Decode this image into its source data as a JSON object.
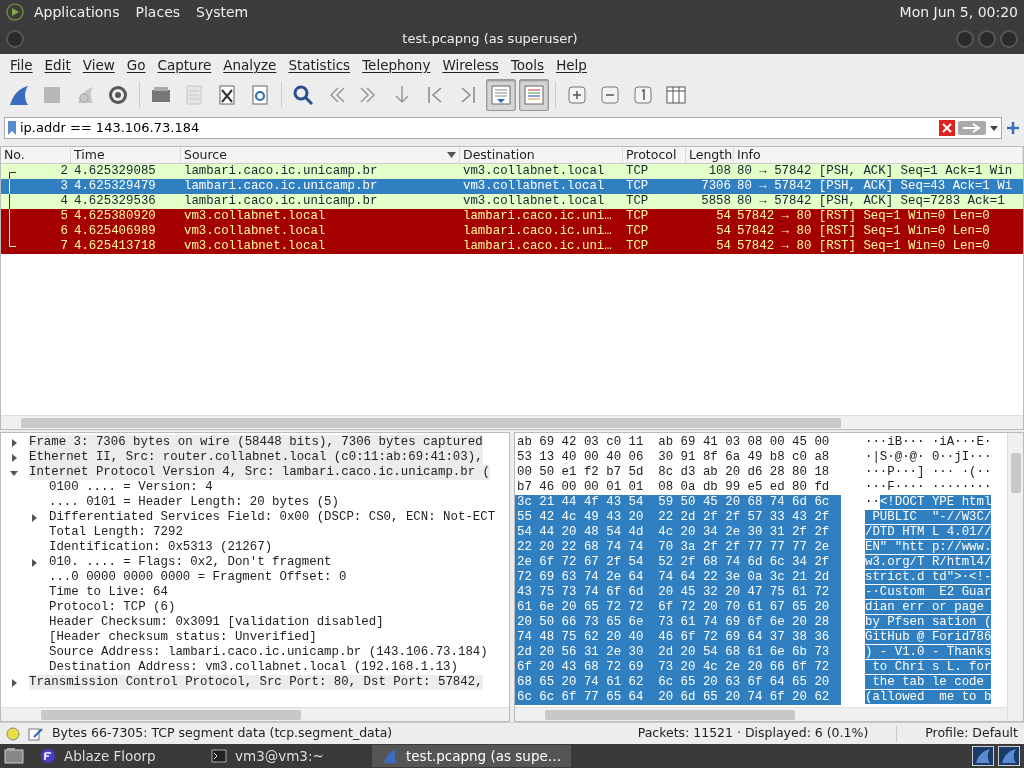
{
  "top_panel": {
    "menus": [
      "Applications",
      "Places",
      "System"
    ],
    "clock": "Mon Jun  5, 00:20"
  },
  "window": {
    "title": "test.pcapng (as superuser)"
  },
  "menu_bar": [
    "File",
    "Edit",
    "View",
    "Go",
    "Capture",
    "Analyze",
    "Statistics",
    "Telephony",
    "Wireless",
    "Tools",
    "Help"
  ],
  "toolbar": [
    [
      {
        "kind": "fin",
        "disabled": false,
        "pressed": false
      },
      {
        "kind": "stop",
        "disabled": true,
        "pressed": false
      },
      {
        "kind": "restart",
        "disabled": true,
        "pressed": false
      },
      {
        "kind": "options",
        "disabled": false,
        "pressed": false
      }
    ],
    [
      {
        "kind": "open",
        "disabled": false,
        "pressed": false
      },
      {
        "kind": "save",
        "disabled": true,
        "pressed": false
      },
      {
        "kind": "close",
        "disabled": false,
        "pressed": false
      },
      {
        "kind": "reload",
        "disabled": false,
        "pressed": false
      }
    ],
    [
      {
        "kind": "find",
        "disabled": false,
        "pressed": false
      },
      {
        "kind": "back",
        "disabled": false,
        "pressed": false
      },
      {
        "kind": "forward",
        "disabled": false,
        "pressed": false
      },
      {
        "kind": "goto",
        "disabled": false,
        "pressed": false
      },
      {
        "kind": "first",
        "disabled": false,
        "pressed": false
      },
      {
        "kind": "last",
        "disabled": false,
        "pressed": false
      },
      {
        "kind": "autoscroll",
        "disabled": false,
        "pressed": true
      },
      {
        "kind": "colorize",
        "disabled": false,
        "pressed": true
      }
    ],
    [
      {
        "kind": "zoom_in",
        "disabled": false,
        "pressed": false
      },
      {
        "kind": "zoom_out",
        "disabled": false,
        "pressed": false
      },
      {
        "kind": "zoom_reset",
        "disabled": false,
        "pressed": false
      },
      {
        "kind": "resize",
        "disabled": false,
        "pressed": false
      }
    ]
  ],
  "filter": {
    "value": "ip.addr == 143.106.73.184"
  },
  "packet_list": {
    "columns": [
      {
        "label": "No.",
        "sorted": false
      },
      {
        "label": "Time",
        "sorted": false
      },
      {
        "label": "Source",
        "sorted": true
      },
      {
        "label": "Destination",
        "sorted": false
      },
      {
        "label": "Protocol",
        "sorted": false
      },
      {
        "label": "Length",
        "sorted": false
      },
      {
        "label": "Info",
        "sorted": false
      }
    ],
    "rows": [
      {
        "cells": [
          "2",
          "4.625329085",
          "lambari.caco.ic.unicamp.br",
          "vm3.collabnet.local",
          "TCP",
          "108",
          "80 → 57842 [PSH, ACK] Seq=1 Ack=1 Win"
        ],
        "color": "#e4ffc7",
        "selected": false
      },
      {
        "cells": [
          "3",
          "4.625329479",
          "lambari.caco.ic.unicamp.br",
          "vm3.collabnet.local",
          "TCP",
          "7306",
          "80 → 57842 [PSH, ACK] Seq=43 Ack=1 Wi"
        ],
        "selected": true
      },
      {
        "cells": [
          "4",
          "4.625329536",
          "lambari.caco.ic.unicamp.br",
          "vm3.collabnet.local",
          "TCP",
          "5858",
          "80 → 57842 [PSH, ACK] Seq=7283 Ack=1"
        ],
        "color": "#e4ffc7",
        "selected": false
      },
      {
        "cells": [
          "5",
          "4.625380920",
          "vm3.collabnet.local",
          "lambari.caco.ic.uni…",
          "TCP",
          "54",
          "57842 → 80 [RST] Seq=1 Win=0 Len=0"
        ],
        "color": "#a40000",
        "selected": false
      },
      {
        "cells": [
          "6",
          "4.625406989",
          "vm3.collabnet.local",
          "lambari.caco.ic.uni…",
          "TCP",
          "54",
          "57842 → 80 [RST] Seq=1 Win=0 Len=0"
        ],
        "color": "#a40000",
        "selected": false
      },
      {
        "cells": [
          "7",
          "4.625413718",
          "vm3.collabnet.local",
          "lambari.caco.ic.uni…",
          "TCP",
          "54",
          "57842 → 80 [RST] Seq=1 Win=0 Len=0"
        ],
        "color": "#a40000",
        "selected": false
      }
    ]
  },
  "details": [
    {
      "text": "Frame 3: 7306 bytes on wire (58448 bits), 7306 bytes captured",
      "expanded": false
    },
    {
      "text": "Ethernet II, Src: router.collabnet.local (c0:11:ab:69:41:03),",
      "expanded": false
    },
    {
      "text": "Internet Protocol Version 4, Src: lambari.caco.ic.unicamp.br (",
      "expanded": true,
      "children": [
        {
          "text": "0100 .... = Version: 4"
        },
        {
          "text": ".... 0101 = Header Length: 20 bytes (5)"
        },
        {
          "text": "Differentiated Services Field: 0x00 (DSCP: CS0, ECN: Not-ECT",
          "expanded": false
        },
        {
          "text": "Total Length: 7292"
        },
        {
          "text": "Identification: 0x5313 (21267)"
        },
        {
          "text": "010. .... = Flags: 0x2, Don't fragment",
          "expanded": false
        },
        {
          "text": "...0 0000 0000 0000 = Fragment Offset: 0"
        },
        {
          "text": "Time to Live: 64"
        },
        {
          "text": "Protocol: TCP (6)"
        },
        {
          "text": "Header Checksum: 0x3091 [validation disabled]"
        },
        {
          "text": "[Header checksum status: Unverified]"
        },
        {
          "text": "Source Address: lambari.caco.ic.unicamp.br (143.106.73.184)"
        },
        {
          "text": "Destination Address: vm3.collabnet.local (192.168.1.13)"
        }
      ]
    },
    {
      "text": "Transmission Control Protocol, Src Port: 80, Dst Port: 57842,",
      "expanded": false
    }
  ],
  "hex_rows": [
    {
      "hex": "ab 69 42 03 c0 11  ab 69 41 03 08 00 45 00",
      "selected": false,
      "ascii": [
        {
          "text": "···iB··· ·iA···E·",
          "selected": false
        }
      ]
    },
    {
      "hex": "53 13 40 00 40 06  30 91 8f 6a 49 b8 c0 a8",
      "selected": false,
      "ascii": [
        {
          "text": "·|S·@·@· 0··jI···",
          "selected": false
        }
      ]
    },
    {
      "hex": "00 50 e1 f2 b7 5d  8c d3 ab 20 d6 28 80 18",
      "selected": false,
      "ascii": [
        {
          "text": "···P···] ··· ·(··",
          "selected": false
        }
      ]
    },
    {
      "hex": "b7 46 00 00 01 01  08 0a db 99 e5 ed 80 fd",
      "selected": false,
      "ascii": [
        {
          "text": "···F···· ········",
          "selected": false
        }
      ]
    },
    {
      "hex": "3c 21 44 4f 43 54  59 50 45 20 68 74 6d 6c",
      "selected": true,
      "ascii": [
        {
          "text": "··",
          "selected": false
        },
        {
          "text": "<!DOCT YPE html",
          "selected": true
        }
      ]
    },
    {
      "hex": "55 42 4c 49 43 20  22 2d 2f 2f 57 33 43 2f",
      "selected": true,
      "ascii": [
        {
          "text": " PUBLIC  \"-//W3C/",
          "selected": true
        }
      ]
    },
    {
      "hex": "54 44 20 48 54 4d  4c 20 34 2e 30 31 2f 2f",
      "selected": true,
      "ascii": [
        {
          "text": "/DTD HTM L 4.01//",
          "selected": true
        }
      ]
    },
    {
      "hex": "22 20 22 68 74 74  70 3a 2f 2f 77 77 77 2e",
      "selected": true,
      "ascii": [
        {
          "text": "EN\" \"htt p://www.",
          "selected": true
        }
      ]
    },
    {
      "hex": "2e 6f 72 67 2f 54  52 2f 68 74 6d 6c 34 2f",
      "selected": true,
      "ascii": [
        {
          "text": "w3.org/T R/html4/",
          "selected": true
        }
      ]
    },
    {
      "hex": "72 69 63 74 2e 64  74 64 22 3e 0a 3c 21 2d",
      "selected": true,
      "ascii": [
        {
          "text": "strict.d td\">·<!-",
          "selected": true
        }
      ]
    },
    {
      "hex": "43 75 73 74 6f 6d  20 45 32 20 47 75 61 72",
      "selected": true,
      "ascii": [
        {
          "text": "-·Custom  E2 Guar",
          "selected": true
        }
      ]
    },
    {
      "hex": "61 6e 20 65 72 72  6f 72 20 70 61 67 65 20",
      "selected": true,
      "ascii": [
        {
          "text": "dian err or page ",
          "selected": true
        }
      ]
    },
    {
      "hex": "20 50 66 73 65 6e  73 61 74 69 6f 6e 20 28",
      "selected": true,
      "ascii": [
        {
          "text": "by Pfsen sation (",
          "selected": true
        }
      ]
    },
    {
      "hex": "74 48 75 62 20 40  46 6f 72 69 64 37 38 36",
      "selected": true,
      "ascii": [
        {
          "text": "GitHub @ Forid786",
          "selected": true
        }
      ]
    },
    {
      "hex": "2d 20 56 31 2e 30  2d 20 54 68 61 6e 6b 73",
      "selected": true,
      "ascii": [
        {
          "text": ") - V1.0 - Thanks",
          "selected": true
        }
      ]
    },
    {
      "hex": "6f 20 43 68 72 69  73 20 4c 2e 20 66 6f 72",
      "selected": true,
      "ascii": [
        {
          "text": " to Chri s L. for",
          "selected": true
        }
      ]
    },
    {
      "hex": "68 65 20 74 61 62  6c 65 20 63 6f 64 65 20",
      "selected": true,
      "ascii": [
        {
          "text": " the tab le code ",
          "selected": true
        }
      ]
    },
    {
      "hex": "6c 6c 6f 77 65 64  20 6d 65 20 74 6f 20 62",
      "selected": true,
      "ascii": [
        {
          "text": "(allowed  me to b",
          "selected": true
        }
      ]
    }
  ],
  "status_bar": {
    "text": "Bytes 66-7305: TCP segment data (tcp.segment_data)",
    "packets": "Packets: 11521 · Displayed: 6 (0.1%)",
    "profile": "Profile: Default"
  },
  "taskbar": [
    {
      "label": "Ablaze Floorp",
      "selected": false
    },
    {
      "label": "vm3@vm3:~",
      "selected": false
    },
    {
      "label": "test.pcapng (as supe…",
      "selected": true
    }
  ]
}
